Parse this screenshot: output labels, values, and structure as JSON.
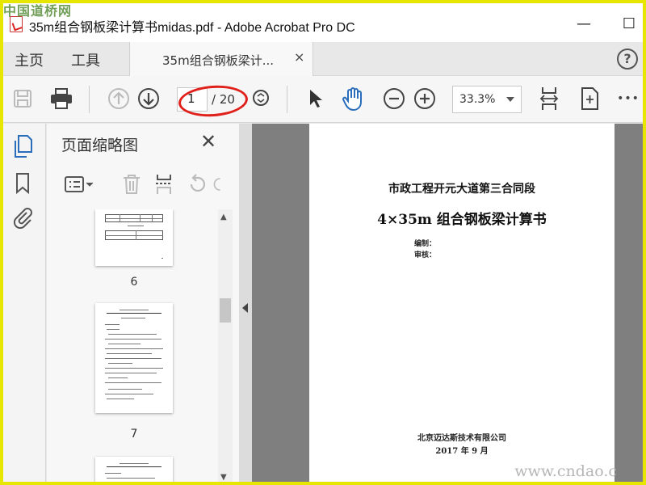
{
  "window": {
    "title": "35m组合钢板梁计算书midas.pdf - Adobe Acrobat Pro DC",
    "minimize": "—",
    "maximize": "☐"
  },
  "watermark": {
    "top_left": "中国道桥网",
    "bottom_right": "www.cndao.c"
  },
  "tabs": {
    "home": "主页",
    "tools": "工具",
    "document": "35m组合钢板梁计...",
    "close": "×",
    "help": "?"
  },
  "toolbar": {
    "page_current": "1",
    "page_total": "/ 20",
    "zoom": "33.3%",
    "more": "•••"
  },
  "thumbnails_panel": {
    "title": "页面缩略图",
    "close": "✕",
    "pages": [
      {
        "label": "6"
      },
      {
        "label": "7"
      }
    ]
  },
  "document": {
    "line1": "市政工程开元大道第三合同段",
    "line2": "4×35m 组合钢板梁计算书",
    "compiled_by": "编制：",
    "reviewed_by": "审核：",
    "company": "北京迈达斯技术有限公司",
    "date": "2017 年 9 月"
  },
  "colors": {
    "frame": "#e6e600",
    "annotation": "#e0201a",
    "accent_blue": "#2a6ebb"
  }
}
